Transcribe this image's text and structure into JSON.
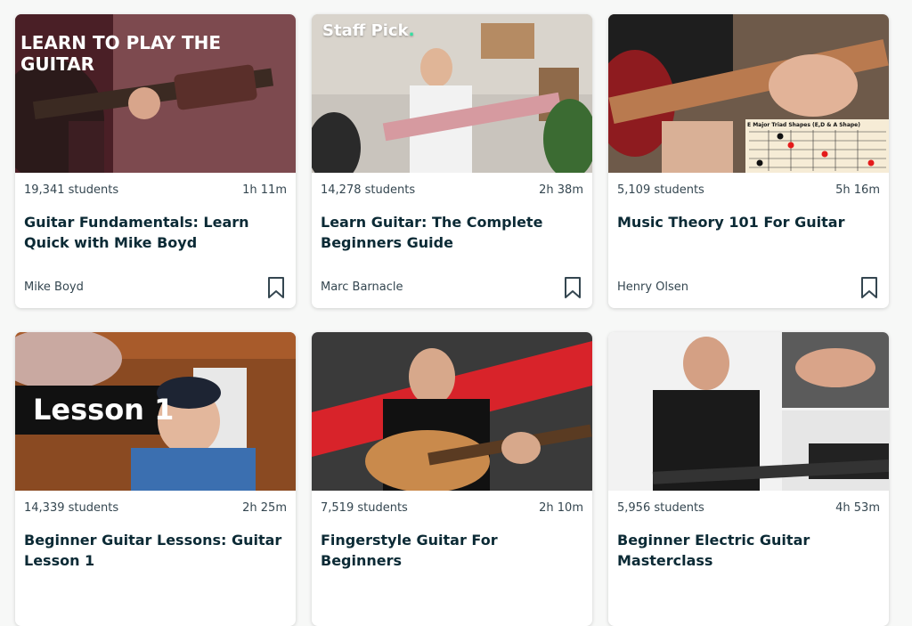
{
  "courses": [
    {
      "students": "19,341 students",
      "duration": "1h 11m",
      "title": "Guitar Fundamentals: Learn Quick with Mike Boyd",
      "author": "Mike Boyd",
      "thumb_text": "LEARN TO PLAY THE GUITAR",
      "bookmark_icon": "bookmark-icon"
    },
    {
      "students": "14,278 students",
      "duration": "2h 38m",
      "title": "Learn Guitar: The Complete Beginners Guide",
      "author": "Marc Barnacle",
      "badge": "Staff Pick",
      "bookmark_icon": "bookmark-icon"
    },
    {
      "students": "5,109 students",
      "duration": "5h 16m",
      "title": "Music Theory 101 For Guitar",
      "author": "Henry Olsen",
      "thumb_text": "E Major Triad Shapes (E,D & A Shape)",
      "bookmark_icon": "bookmark-icon"
    },
    {
      "students": "14,339 students",
      "duration": "2h 25m",
      "title": "Beginner Guitar Lessons: Guitar Lesson 1",
      "thumb_text": "Lesson 1"
    },
    {
      "students": "7,519 students",
      "duration": "2h 10m",
      "title": "Fingerstyle Guitar For Beginners"
    },
    {
      "students": "5,956 students",
      "duration": "4h 53m",
      "title": "Beginner Electric Guitar Masterclass"
    }
  ],
  "colors": {
    "title": "#0b2a35",
    "meta": "#344650",
    "badge_dot": "#34e0a1"
  }
}
